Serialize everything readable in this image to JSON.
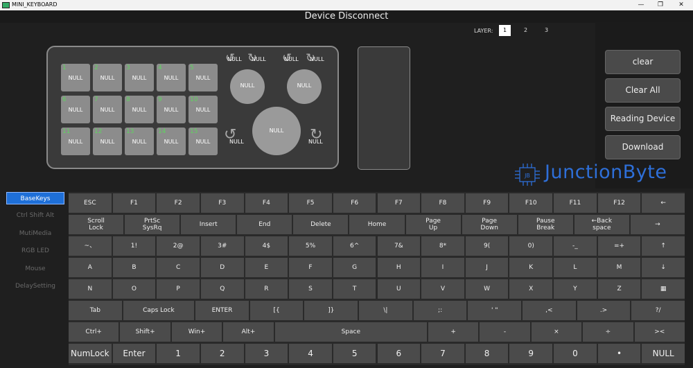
{
  "window": {
    "title": "MINI_KEYBOARD",
    "controls": {
      "minimize": "—",
      "maximize": "❐",
      "close": "✕"
    }
  },
  "header": {
    "status": "Device Disconnect"
  },
  "layers": {
    "label": "LAYER:",
    "options": [
      "1",
      "2",
      "3"
    ],
    "selected": "1"
  },
  "device": {
    "keys": [
      {
        "num": "1",
        "label": "NULL"
      },
      {
        "num": "2",
        "label": "NULL"
      },
      {
        "num": "3",
        "label": "NULL"
      },
      {
        "num": "4",
        "label": "NULL"
      },
      {
        "num": "5",
        "label": "NULL"
      },
      {
        "num": "6",
        "label": "NULL"
      },
      {
        "num": "7",
        "label": "NULL"
      },
      {
        "num": "8",
        "label": "NULL"
      },
      {
        "num": "9",
        "label": "NULL"
      },
      {
        "num": "10",
        "label": "NULL"
      },
      {
        "num": "11",
        "label": "NULL"
      },
      {
        "num": "12",
        "label": "NULL"
      },
      {
        "num": "13",
        "label": "NULL"
      },
      {
        "num": "14",
        "label": "NULL"
      },
      {
        "num": "15",
        "label": "NULL"
      }
    ],
    "knobs": {
      "small_left": {
        "press": "NULL",
        "ccw": "NULL",
        "cw": "NULL"
      },
      "small_right": {
        "press": "NULL",
        "ccw": "NULL",
        "cw": "NULL"
      },
      "big": {
        "press": "NULL",
        "ccw": "NULL",
        "cw": "NULL"
      }
    }
  },
  "actions": {
    "clear": "clear",
    "clear_all": "Clear All",
    "reading": "Reading Device",
    "download": "Download"
  },
  "brand": {
    "name": "JunctionByte",
    "logo_text": "JB"
  },
  "sidebar": {
    "items": [
      {
        "label": "BaseKeys",
        "active": true
      },
      {
        "label": "Ctrl Shift Alt",
        "active": false
      },
      {
        "label": "MutiMedia",
        "active": false
      },
      {
        "label": "RGB LED",
        "active": false
      },
      {
        "label": "Mouse",
        "active": false
      },
      {
        "label": "DelaySetting",
        "active": false
      }
    ]
  },
  "keyboard": {
    "rows": [
      [
        "ESC",
        "F1",
        "F2",
        "F3",
        "F4",
        "F5",
        "F6",
        "F7",
        "F8",
        "F9",
        "F10",
        "F11",
        "F12",
        "←"
      ],
      [
        "Scroll\nLock",
        "PrtSc\nSysRq",
        "Insert",
        "End",
        "Delete",
        "Home",
        "Page\nUp",
        "Page\nDown",
        "Pause\nBreak",
        "←Back\nspace",
        "→"
      ],
      [
        "~、",
        "1!",
        "2@",
        "3#",
        "4$",
        "5%",
        "6^",
        "7&",
        "8*",
        "9(",
        "0)",
        "-_",
        "=+",
        "↑"
      ],
      [
        "A",
        "B",
        "C",
        "D",
        "E",
        "F",
        "G",
        "H",
        "I",
        "J",
        "K",
        "L",
        "M",
        "↓"
      ],
      [
        "N",
        "O",
        "P",
        "Q",
        "R",
        "S",
        "T",
        "U",
        "V",
        "W",
        "X",
        "Y",
        "Z",
        "▦"
      ],
      [
        "Tab",
        "Caps Lock",
        "ENTER",
        "[{",
        "]}",
        "\\|",
        ";:",
        "' \"",
        ",<",
        ".>",
        "?/"
      ],
      [
        "Ctrl+",
        "Shift+",
        "Win+",
        "Alt+",
        "Space",
        "+",
        "-",
        "×",
        "÷",
        "><"
      ],
      [
        "NumLock",
        "Enter",
        "1",
        "2",
        "3",
        "4",
        "5",
        "6",
        "7",
        "8",
        "9",
        "0",
        "•",
        "NULL"
      ]
    ]
  },
  "colors": {
    "accent": "#1e6fd8",
    "key_number": "#5fd35f",
    "brand": "#2e6fd8"
  }
}
